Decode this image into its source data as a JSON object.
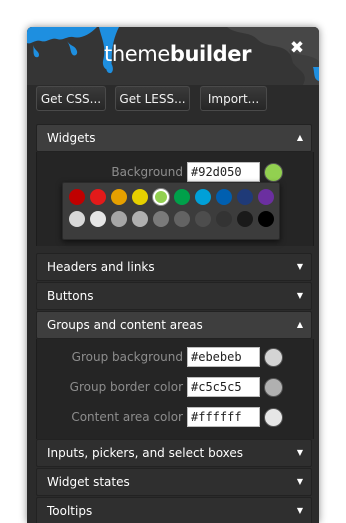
{
  "app": {
    "title_thin": "theme",
    "title_bold": "builder"
  },
  "toolbar": {
    "get_css": "Get CSS...",
    "get_less": "Get LESS...",
    "import": "Import..."
  },
  "icons": {
    "close": "close-icon",
    "expand": "chevron-down-icon",
    "collapse": "chevron-up-icon"
  },
  "sections": {
    "widgets": "Widgets",
    "headers": "Headers and links",
    "buttons": "Buttons",
    "groups": "Groups and content areas",
    "inputs": "Inputs, pickers, and select boxes",
    "states": "Widget states",
    "tooltips": "Tooltips"
  },
  "widgets": {
    "background_label": "Background",
    "background_value": "#92d050",
    "background_color": "#92d050"
  },
  "palette": {
    "row1": [
      "#c00000",
      "#e31a1a",
      "#e6a000",
      "#e6d000",
      "#92d050",
      "#00a04a",
      "#00a0d8",
      "#005fb0",
      "#1f3a78",
      "#6b2fa0"
    ],
    "row2": [
      "#d9d9d9",
      "#e6e6e6",
      "#a6a6a6",
      "#b0b0b0",
      "#7a7a7a",
      "#636363",
      "#4d4d4d",
      "#333333",
      "#1a1a1a",
      "#000000"
    ],
    "selected_index": 4
  },
  "groups": {
    "group_background_label": "Group background",
    "group_background_value": "#ebebeb",
    "group_border_label": "Group border color",
    "group_border_value": "#c5c5c5",
    "content_area_label": "Content area color",
    "content_area_value": "#ffffff"
  }
}
